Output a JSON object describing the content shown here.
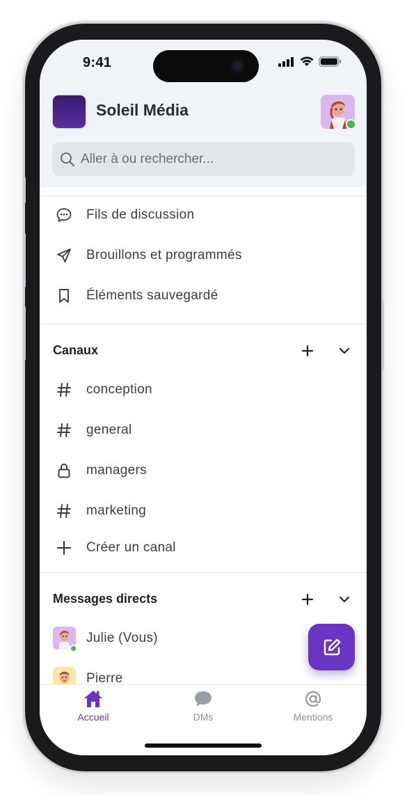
{
  "status_bar": {
    "time": "9:41"
  },
  "workspace": {
    "name": "Soleil Média"
  },
  "search": {
    "placeholder": "Aller à ou rechercher..."
  },
  "quick_links": [
    {
      "icon": "speech-bubble-icon",
      "label": "Fils de discussion"
    },
    {
      "icon": "paper-plane-icon",
      "label": "Brouillons et programmés"
    },
    {
      "icon": "bookmark-icon",
      "label": "Éléments sauvegardé"
    }
  ],
  "channels": {
    "title": "Canaux",
    "items": [
      {
        "icon": "hash-icon",
        "label": "conception"
      },
      {
        "icon": "hash-icon",
        "label": "general"
      },
      {
        "icon": "lock-icon",
        "label": "managers"
      },
      {
        "icon": "hash-icon",
        "label": "marketing"
      }
    ],
    "create_label": "Créer un canal"
  },
  "direct_messages": {
    "title": "Messages directs",
    "items": [
      {
        "label": "Julie (Vous)",
        "online": true
      },
      {
        "label": "Pierre",
        "online": false
      }
    ]
  },
  "tabs": [
    {
      "label": "Accueil",
      "icon": "home-icon",
      "active": true
    },
    {
      "label": "DMs",
      "icon": "chat-bubble-icon",
      "active": false
    },
    {
      "label": "Mentions",
      "icon": "at-sign-icon",
      "active": false
    }
  ],
  "colors": {
    "accent": "#6a35c5",
    "online": "#3fb950",
    "header_bg": "#f1f4f7"
  }
}
